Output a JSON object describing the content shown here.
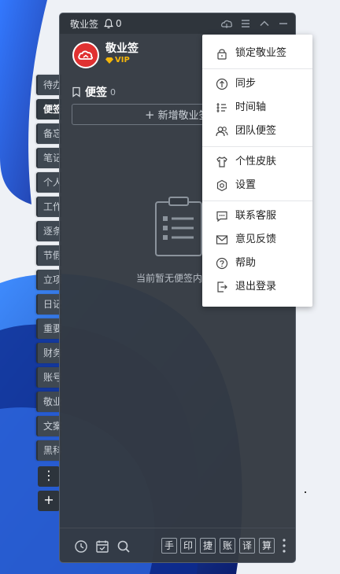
{
  "window": {
    "title": "敬业签",
    "notification_count": "0"
  },
  "profile": {
    "name": "敬业签",
    "badge": "VIP"
  },
  "notes": {
    "title": "便签",
    "count": "0",
    "new_button": "新增敬业签",
    "empty_text": "当前暂无便签内容"
  },
  "side_tabs": [
    "待办",
    "便签",
    "备忘",
    "笔记",
    "个人",
    "工作",
    "逐条",
    "节假",
    "立项",
    "日记",
    "重要",
    "财务",
    "账号",
    "敬业",
    "文案",
    "黑科"
  ],
  "side_buttons": {
    "more": "⋮",
    "add": "+"
  },
  "menu": {
    "items": [
      {
        "label": "锁定敬业签",
        "icon": "lock-icon"
      },
      {
        "label": "同步",
        "icon": "sync-icon"
      },
      {
        "label": "时间轴",
        "icon": "timeline-icon"
      },
      {
        "label": "团队便签",
        "icon": "team-icon"
      },
      {
        "label": "个性皮肤",
        "icon": "skin-icon"
      },
      {
        "label": "设置",
        "icon": "settings-icon"
      },
      {
        "label": "联系客服",
        "icon": "chat-icon"
      },
      {
        "label": "意见反馈",
        "icon": "mail-icon"
      },
      {
        "label": "帮助",
        "icon": "help-icon"
      },
      {
        "label": "退出登录",
        "icon": "logout-icon"
      }
    ]
  },
  "bottom_bar": {
    "tools": [
      "手",
      "印",
      "捷",
      "账",
      "译",
      "算"
    ]
  },
  "colors": {
    "accent_red": "#e03131",
    "vip_gold": "#f5b60a",
    "window_bg": "#343a42"
  }
}
